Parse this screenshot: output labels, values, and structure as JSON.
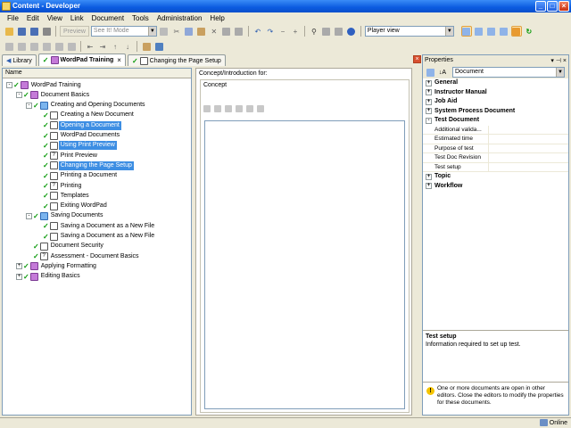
{
  "window": {
    "title": "Content - Developer"
  },
  "menu": [
    "File",
    "Edit",
    "View",
    "Link",
    "Document",
    "Tools",
    "Administration",
    "Help"
  ],
  "toolbar": {
    "preview_label": "Preview",
    "mode_value": "See It! Mode",
    "player_value": "Player view"
  },
  "tabs": [
    {
      "label": "Library",
      "active": false
    },
    {
      "label": "WordPad Training",
      "active": true
    },
    {
      "label": "Changing the Page Setup",
      "active": false
    }
  ],
  "left": {
    "header": "Name"
  },
  "tree": [
    {
      "label": "WordPad Training",
      "level": 0,
      "icon": "book",
      "expander": "-",
      "selected": false
    },
    {
      "label": "Document Basics",
      "level": 1,
      "icon": "book",
      "expander": "-",
      "selected": false
    },
    {
      "label": "Creating and Opening Documents",
      "level": 2,
      "icon": "folder",
      "expander": "-",
      "selected": false
    },
    {
      "label": "Creating a New Document",
      "level": 3,
      "icon": "doc",
      "expander": "",
      "selected": false
    },
    {
      "label": "Opening a Document",
      "level": 3,
      "icon": "doc",
      "expander": "",
      "selected": true
    },
    {
      "label": "WordPad Documents",
      "level": 3,
      "icon": "doc",
      "expander": "",
      "selected": false
    },
    {
      "label": "Using Print Preview",
      "level": 3,
      "icon": "doc",
      "expander": "",
      "selected": true
    },
    {
      "label": "Print Preview",
      "level": 3,
      "icon": "q",
      "expander": "",
      "selected": false
    },
    {
      "label": "Changing the Page Setup",
      "level": 3,
      "icon": "doc",
      "expander": "",
      "selected": true
    },
    {
      "label": "Printing a Document",
      "level": 3,
      "icon": "doc",
      "expander": "",
      "selected": false
    },
    {
      "label": "Printing",
      "level": 3,
      "icon": "q",
      "expander": "",
      "selected": false
    },
    {
      "label": "Templates",
      "level": 3,
      "icon": "doc",
      "expander": "",
      "selected": false
    },
    {
      "label": "Exiting WordPad",
      "level": 3,
      "icon": "doc",
      "expander": "",
      "selected": false
    },
    {
      "label": "Saving Documents",
      "level": 2,
      "icon": "folder",
      "expander": "-",
      "selected": false
    },
    {
      "label": "Saving a Document as a New File",
      "level": 3,
      "icon": "doc",
      "expander": "",
      "selected": false
    },
    {
      "label": "Saving a Document as a New File",
      "level": 3,
      "icon": "doc",
      "expander": "",
      "selected": false
    },
    {
      "label": "Document Security",
      "level": 2,
      "icon": "doc",
      "expander": "",
      "selected": false
    },
    {
      "label": "Assessment - Document Basics",
      "level": 2,
      "icon": "q",
      "expander": "",
      "selected": false
    },
    {
      "label": "Applying Formatting",
      "level": 1,
      "icon": "book",
      "expander": "+",
      "selected": false
    },
    {
      "label": "Editing Basics",
      "level": 1,
      "icon": "book",
      "expander": "+",
      "selected": false
    }
  ],
  "middle": {
    "header": "Concept/Introduction for:",
    "concept_label": "Concept"
  },
  "properties": {
    "title": "Properties",
    "selector": "Document",
    "categories": [
      {
        "name": "General",
        "expander": "+"
      },
      {
        "name": "Instructor Manual",
        "expander": "+"
      },
      {
        "name": "Job Aid",
        "expander": "+"
      },
      {
        "name": "System Process Document",
        "expander": "+"
      },
      {
        "name": "Test Document",
        "expander": "-"
      }
    ],
    "test_document_props": [
      "Additional valida...",
      "Estimated time",
      "Purpose of test",
      "Test Doc Revision",
      "Test setup"
    ],
    "more_categories": [
      {
        "name": "Topic",
        "expander": "+"
      },
      {
        "name": "Workflow",
        "expander": "+"
      }
    ],
    "desc_title": "Test setup",
    "desc_text": "Information required to set up test.",
    "warning": "One or more documents are open in other editors. Close the editors to modify the properties for these documents."
  },
  "status": {
    "online": "Online"
  },
  "colors": {
    "selection": "#3d8ee3",
    "titlebar": "#0b5be0",
    "check": "#0a9a0a"
  }
}
